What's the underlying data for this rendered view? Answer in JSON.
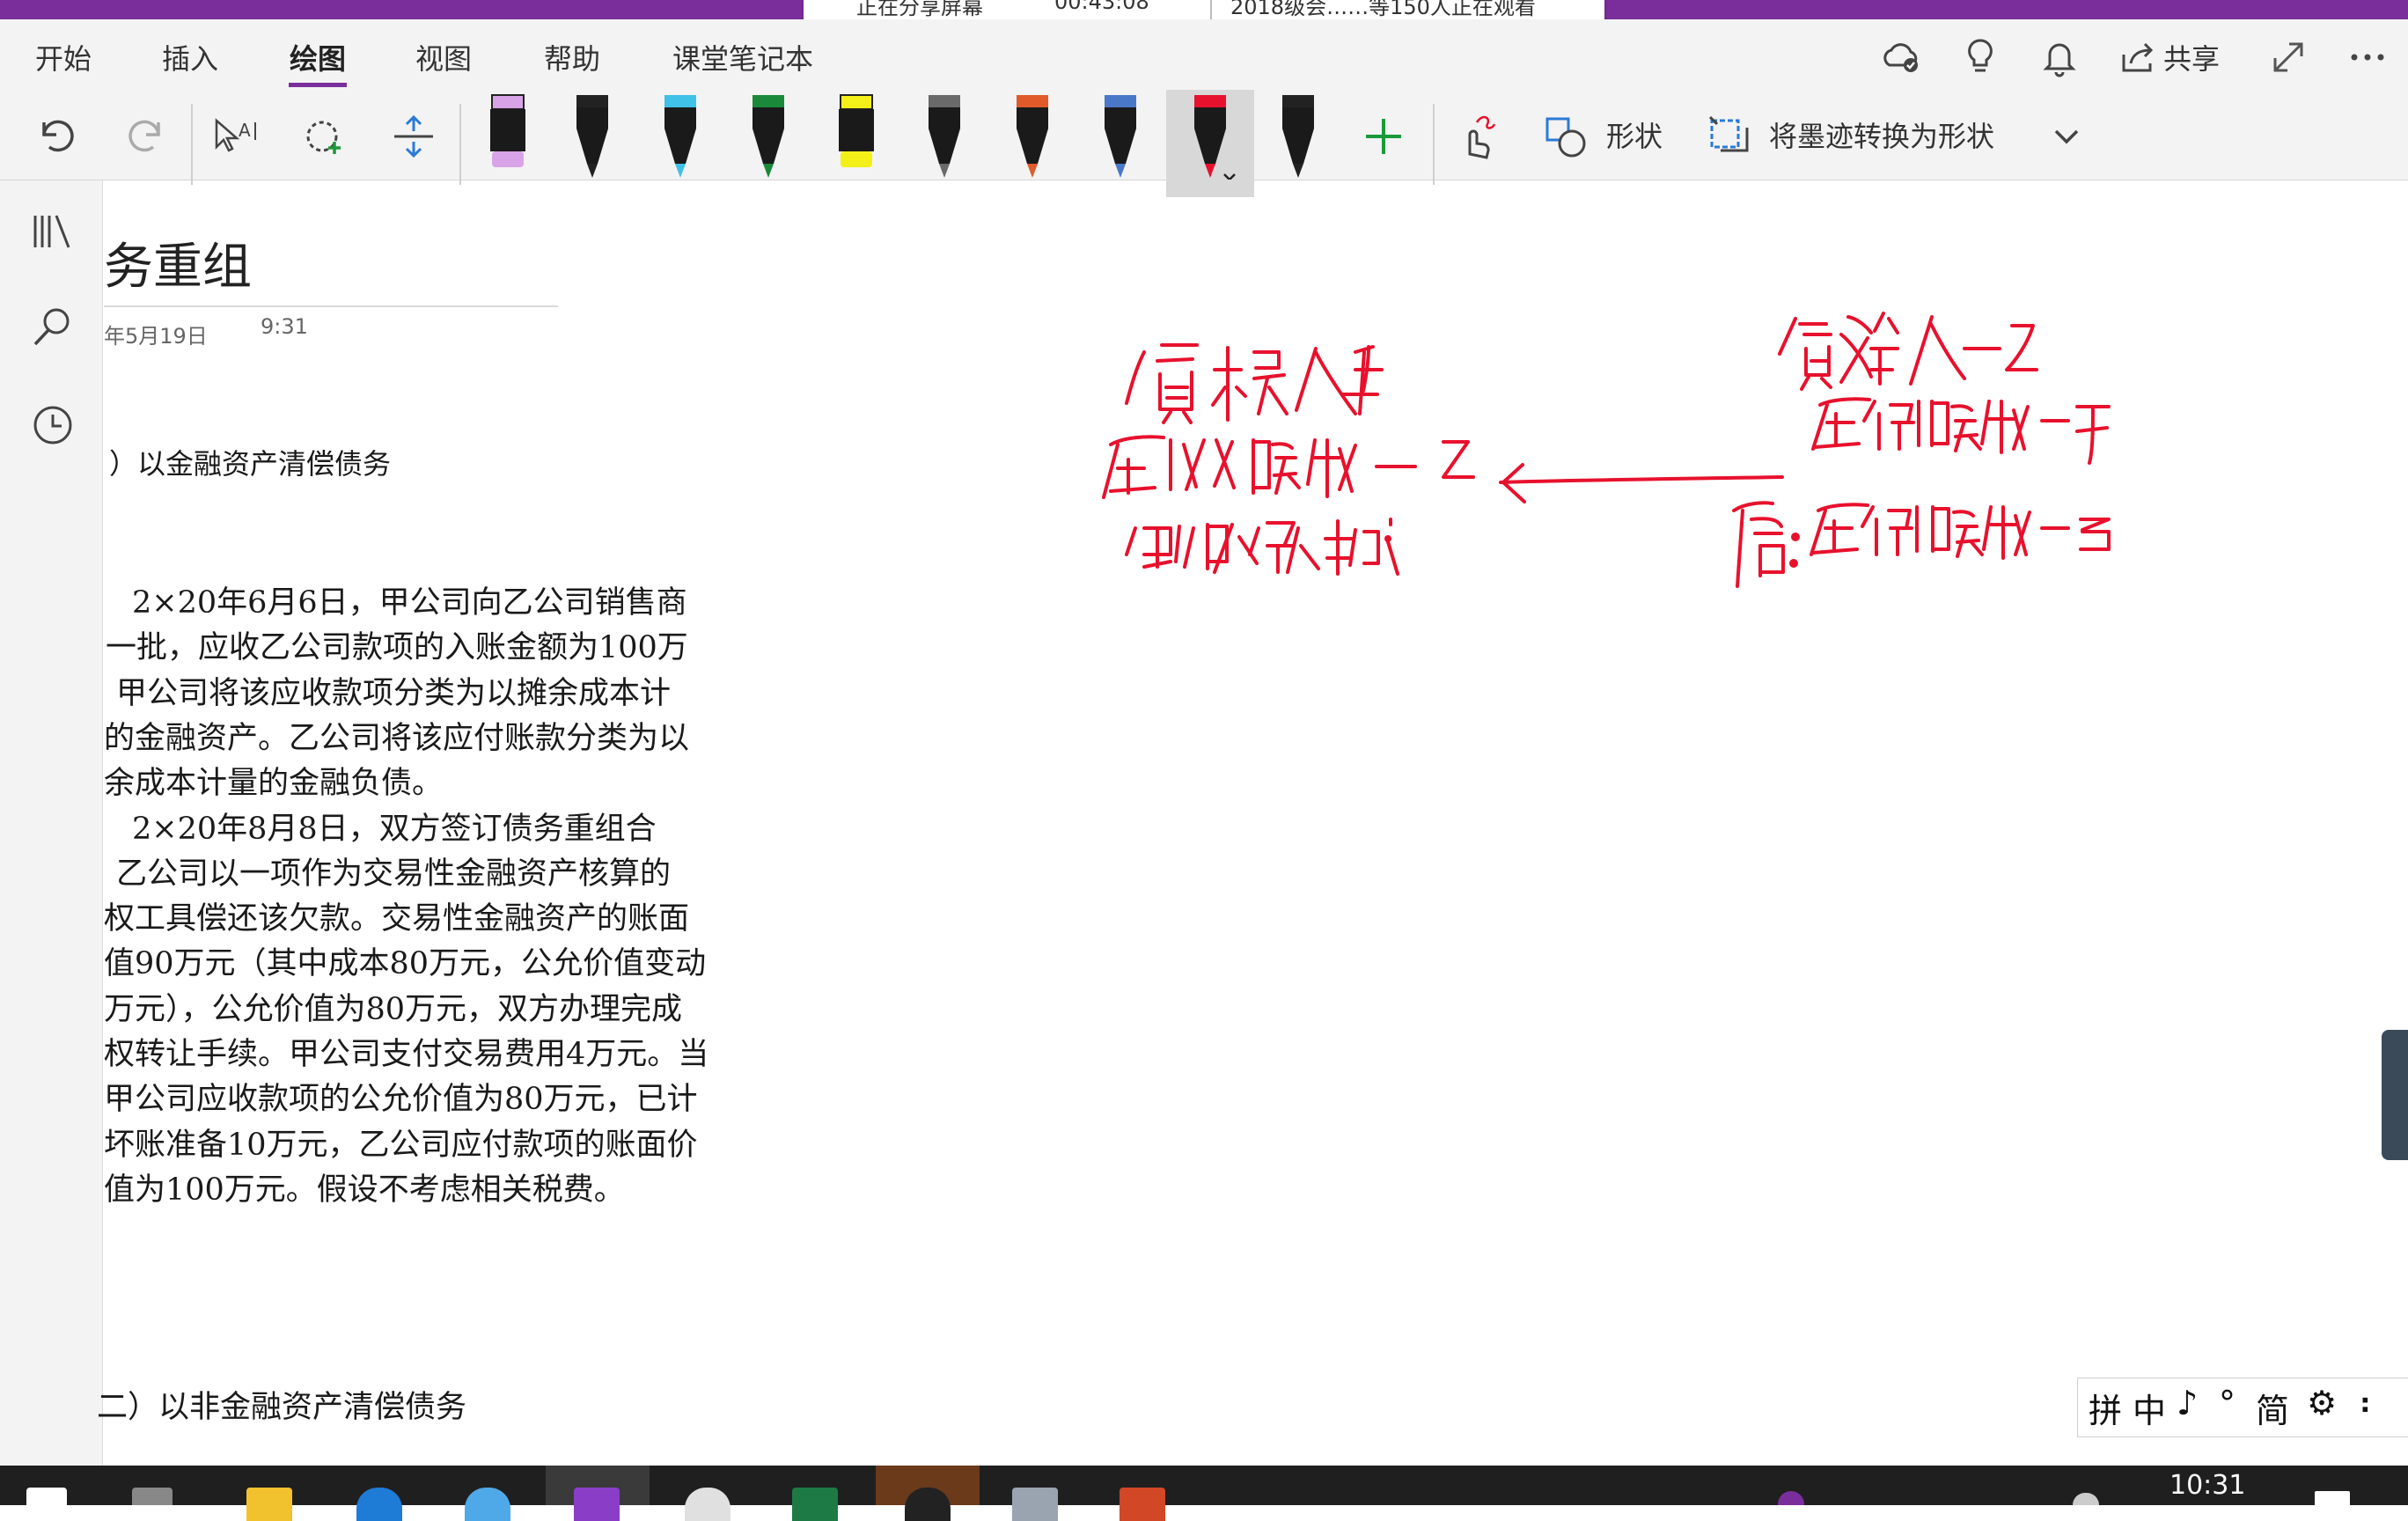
{
  "screen_share": {
    "status": "正在分享屏幕",
    "timer": "00:43:08",
    "viewers": "2018级会……等150人正在观看"
  },
  "ribbon": {
    "tabs": [
      {
        "label": "开始"
      },
      {
        "label": "插入"
      },
      {
        "label": "绘图",
        "active": true
      },
      {
        "label": "视图"
      },
      {
        "label": "帮助"
      },
      {
        "label": "课堂笔记本"
      }
    ],
    "share_label": "共享",
    "shapes_label": "形状",
    "ink_to_shape_label": "将墨迹转换为形状",
    "pens": [
      {
        "name": "pink-highlighter",
        "color": "#d9a3e8"
      },
      {
        "name": "black-pen",
        "color": "#222222"
      },
      {
        "name": "cyan-pen",
        "color": "#3fc1e8"
      },
      {
        "name": "green-pen",
        "color": "#1a8a3a"
      },
      {
        "name": "yellow-highlighter",
        "color": "#f3ef19"
      },
      {
        "name": "galaxy-pen",
        "color": "#6a6a6a"
      },
      {
        "name": "rainbow-pen",
        "color": "#e05a2a"
      },
      {
        "name": "blue-galaxy-pen",
        "color": "#4a78c8"
      },
      {
        "name": "red-pen",
        "color": "#e8112d",
        "selected": true
      },
      {
        "name": "black-pen-2",
        "color": "#222222"
      }
    ]
  },
  "page": {
    "title": "务重组",
    "date": "年5月19日",
    "time": "9:31",
    "section1_heading": "）以金融资产清偿债务",
    "paragraphs": [
      "2×20年6月6日，甲公司向乙公司销售商",
      "一批，应收乙公司款项的入账金额为100万",
      "甲公司将该应收款项分类为以摊余成本计",
      "的金融资产。乙公司将该应付账款分类为以",
      "余成本计量的金融负债。",
      "2×20年8月8日，双方签订债务重组合",
      "乙公司以一项作为交易性金融资产核算的",
      "权工具偿还该欠款。交易性金融资产的账面",
      "值90万元（其中成本80万元，公允价值变动",
      "万元），公允价值为80万元，双方办理完成",
      "权转让手续。甲公司支付交易费用4万元。当",
      "甲公司应收款项的公允价值为80万元，已计",
      "坏账准备10万元，乙公司应付款项的账面价",
      "值为100万元。假设不考虑相关税费。"
    ],
    "section2_heading": "二）以非金融资产清偿债务"
  },
  "ime": {
    "items": [
      "拼",
      "中",
      "♪",
      "°",
      "简",
      "⚙",
      "⠆"
    ]
  },
  "taskbar": {
    "clock": "10:31"
  },
  "colors": {
    "accent": "#7a2e9b",
    "ink": "#e8112d"
  }
}
